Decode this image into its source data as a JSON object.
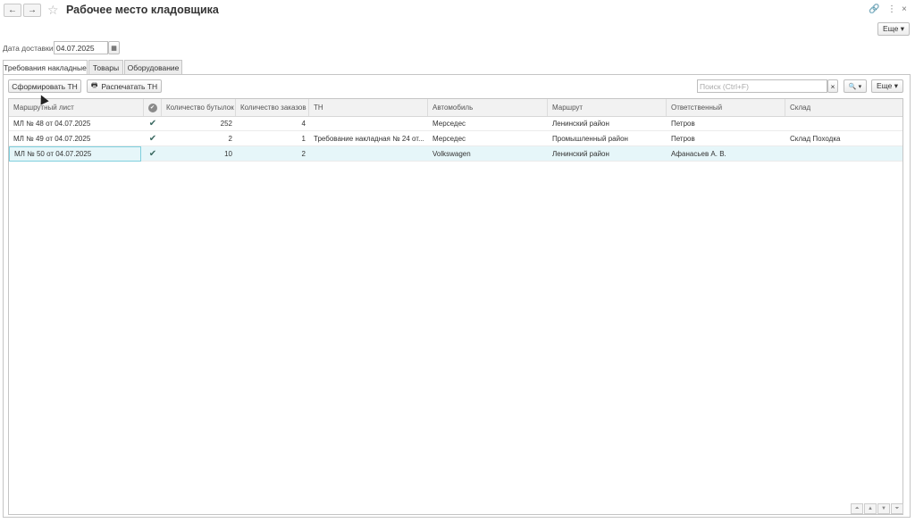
{
  "window": {
    "title": "Рабочее место кладовщика",
    "back_icon": "←",
    "forward_icon": "→",
    "star_icon": "☆",
    "link_icon": "🔗",
    "menu_icon": "⋮",
    "close_icon": "×",
    "more_label": "Еще ▾"
  },
  "delivery": {
    "label": "Дата доставки:",
    "value": "04.07.2025",
    "calendar_icon": "▦"
  },
  "tabs": [
    {
      "label": "Требования накладные"
    },
    {
      "label": "Товары"
    },
    {
      "label": "Оборудование"
    }
  ],
  "toolbar": {
    "form_label": "Сформировать ТН",
    "print_label": "Распечатать ТН",
    "print_icon": "🖶",
    "search_placeholder": "Поиск (Ctrl+F)",
    "search_clear": "×",
    "search_icon": "🔍 ▾",
    "more_label": "Еще ▾"
  },
  "table": {
    "columns": [
      "Маршрутный лист",
      "✔",
      "Количество бутылок",
      "Количество заказов",
      "ТН",
      "Автомобиль",
      "Маршрут",
      "Ответственный",
      "Склад"
    ],
    "rows": [
      {
        "route_list": "МЛ № 48 от 04.07.2025",
        "check": "✔",
        "bottles": "252",
        "orders": "4",
        "tn": "",
        "car": "Мерседес",
        "route": "Ленинский район",
        "responsible": "Петров",
        "warehouse": ""
      },
      {
        "route_list": "МЛ № 49 от 04.07.2025",
        "check": "✔",
        "bottles": "2",
        "orders": "1",
        "tn": "Требование накладная № 24 от...",
        "car": "Мерседес",
        "route": "Промышленный район",
        "responsible": "Петров",
        "warehouse": "Склад Походка"
      },
      {
        "route_list": "МЛ № 50 от 04.07.2025",
        "check": "✔",
        "bottles": "10",
        "orders": "2",
        "tn": "",
        "car": "Volkswagen",
        "route": "Ленинский район",
        "responsible": "Афанасьев А. В.",
        "warehouse": ""
      }
    ]
  },
  "scroll": {
    "top": "⏶",
    "up": "▲",
    "down": "▼",
    "bottom": "⏷"
  }
}
